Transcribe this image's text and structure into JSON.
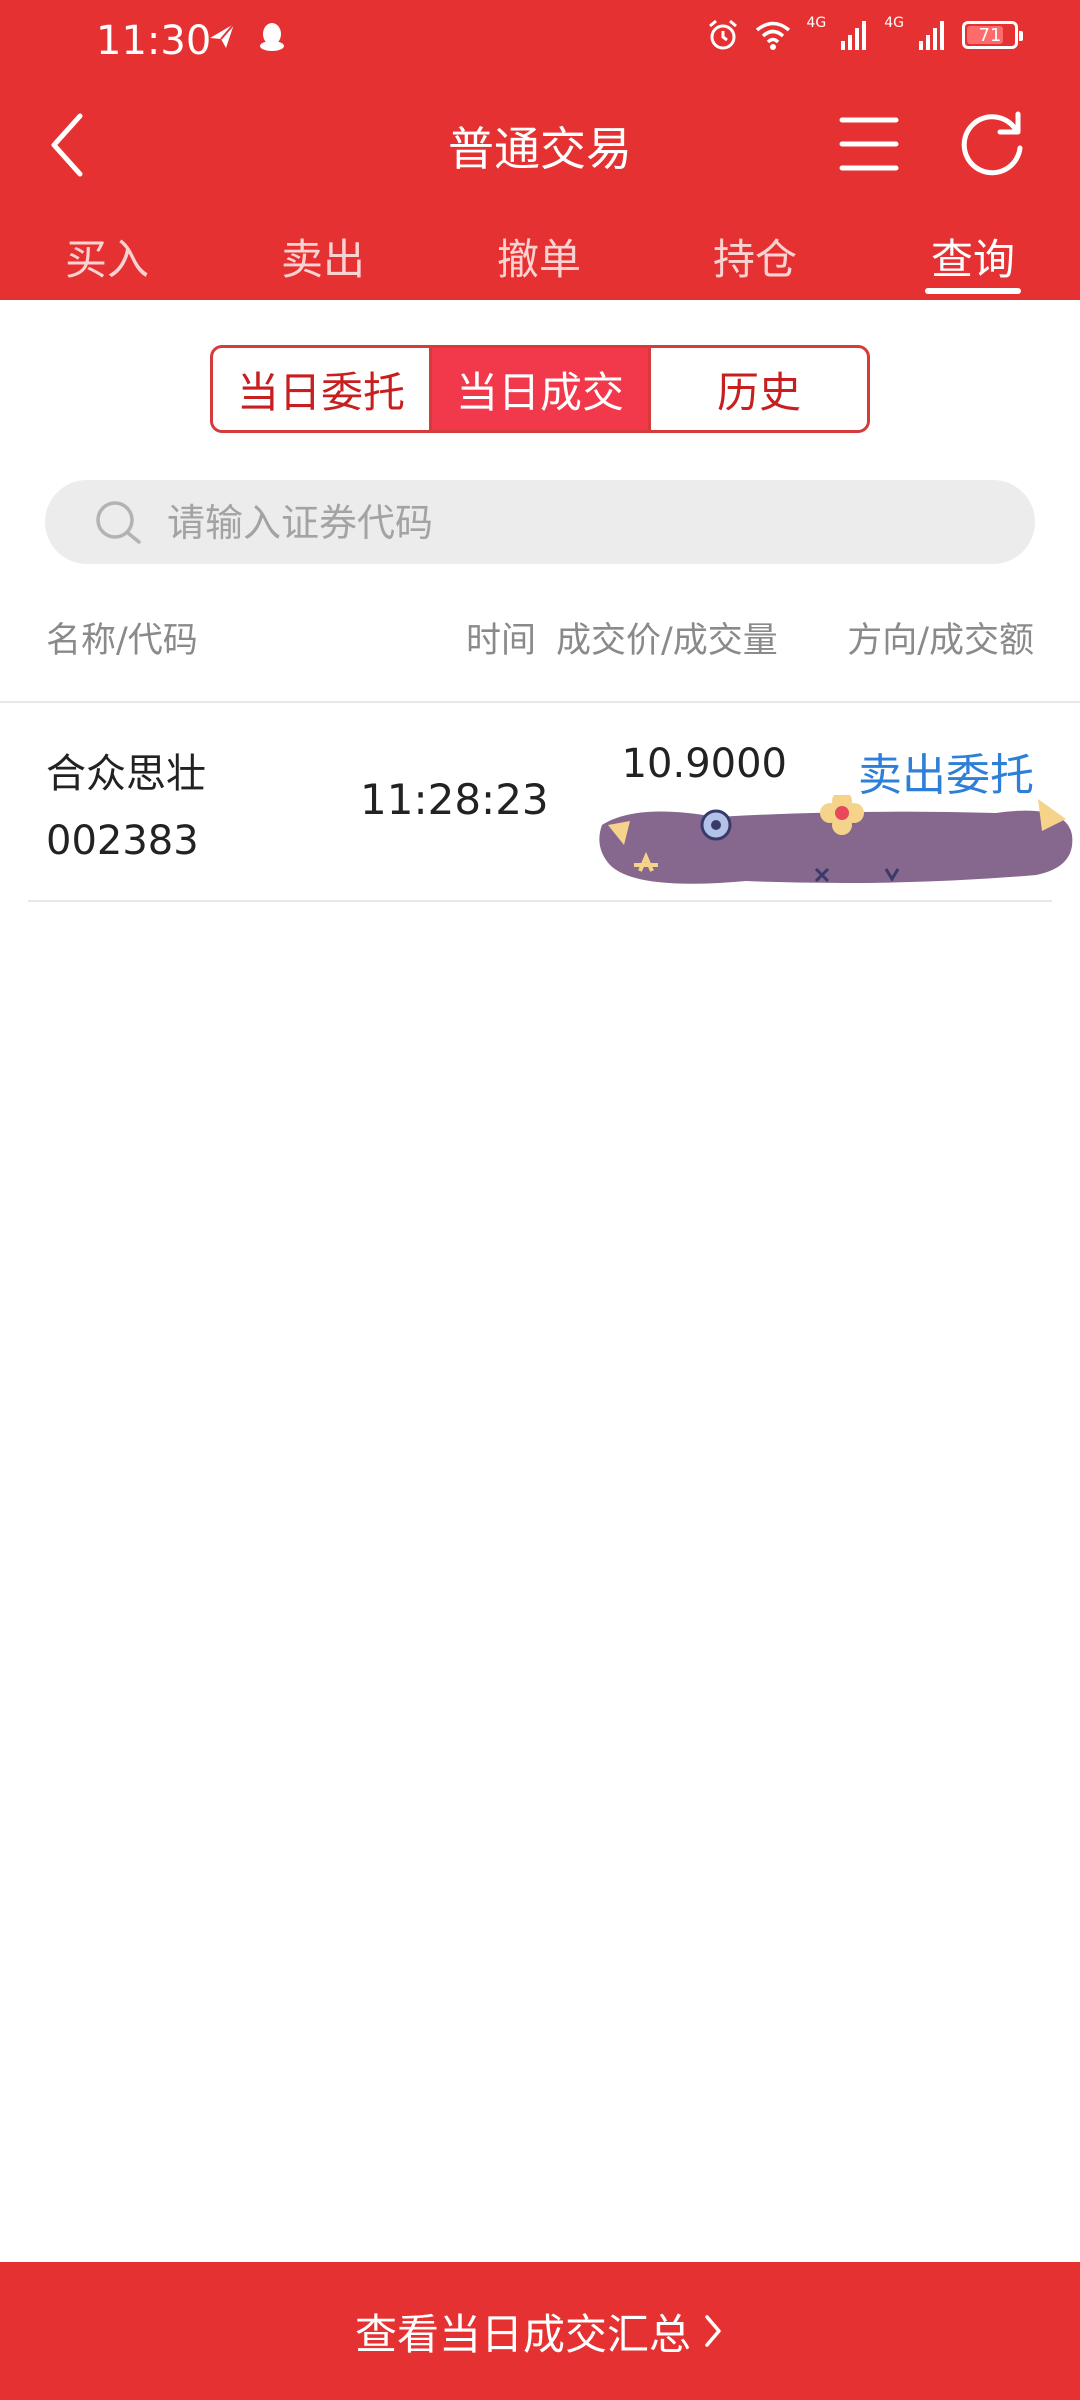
{
  "colors": {
    "brand": "#e53131",
    "active_segment": "#f2394c",
    "direction_blue": "#2d7fd8"
  },
  "status_bar": {
    "time": "11:30",
    "left_icons": [
      "paper-plane-icon",
      "qq-penguin-icon"
    ],
    "right_icons": [
      "alarm-icon",
      "wifi-icon",
      "signal-4g-icon",
      "signal-4g-icon",
      "battery-icon"
    ],
    "network_label_1": "4G",
    "network_label_2": "4G",
    "battery_level": "71"
  },
  "nav": {
    "title": "普通交易",
    "back_icon": "chevron-left-icon",
    "menu_icon": "menu-icon",
    "refresh_icon": "refresh-icon"
  },
  "tabs": [
    {
      "label": "买入",
      "active": false
    },
    {
      "label": "卖出",
      "active": false
    },
    {
      "label": "撤单",
      "active": false
    },
    {
      "label": "持仓",
      "active": false
    },
    {
      "label": "查询",
      "active": true
    }
  ],
  "segments": [
    {
      "label": "当日委托",
      "active": false
    },
    {
      "label": "当日成交",
      "active": true
    },
    {
      "label": "历史",
      "active": false
    }
  ],
  "search": {
    "placeholder": "请输入证券代码",
    "value": ""
  },
  "columns": {
    "name_code": "名称/代码",
    "time": "时间",
    "price_volume": "成交价/成交量",
    "direction_amount": "方向/成交额"
  },
  "rows": [
    {
      "name": "合众思壮",
      "code": "002383",
      "time": "11:28:23",
      "price": "10.9000",
      "direction": "卖出委托"
    }
  ],
  "bottom_bar": {
    "label": "查看当日成交汇总"
  }
}
